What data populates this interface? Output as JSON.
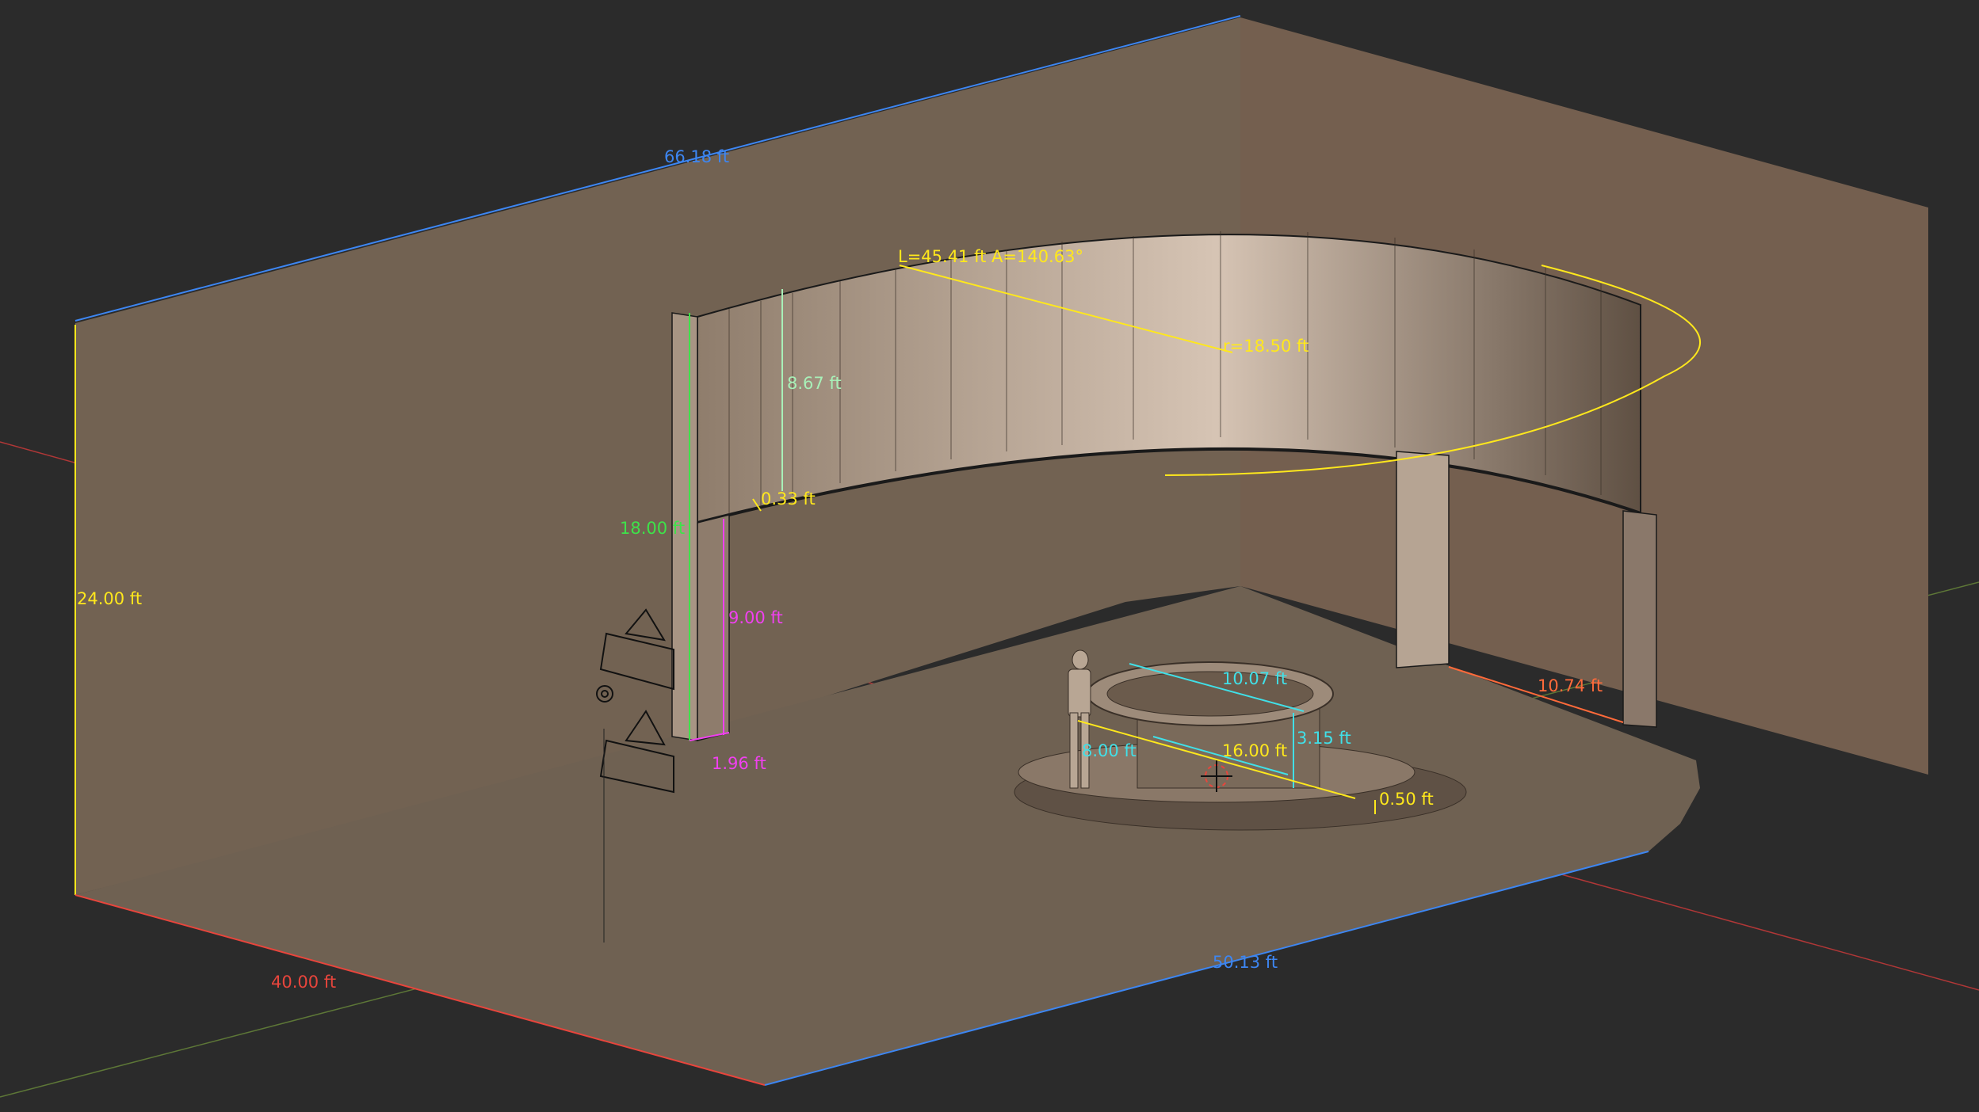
{
  "colors": {
    "background": "#2b2b2b",
    "wall": "#726252",
    "floor": "#6f6152",
    "screen_light": "#d2c0b0",
    "screen_dark": "#5f5043",
    "x_axis": "#d23a3a",
    "y_axis": "#6a8a3a",
    "blue_dim": "#3d86f2",
    "red_dim": "#e8453c",
    "yellow_dim": "#ffe81c",
    "green_dim": "#3ee24a",
    "cyan_dim": "#40e0e8",
    "magenta_dim": "#f040f0",
    "mint_dim": "#a8f0b8",
    "orange_dim": "#ff6a3a"
  },
  "dimensions": {
    "top_wall_length": "66.18 ft",
    "wall_height": "24.00 ft",
    "left_floor_depth": "40.00 ft",
    "front_floor_width": "50.13 ft",
    "arc_info": "L=45.41 ft A=140.63°",
    "arc_radius": "r=18.50 ft",
    "screen_height": "8.67 ft",
    "screen_thickness": "0.33 ft",
    "screen_top_height": "18.00 ft",
    "pillar_height": "9.00 ft",
    "pillar_width": "1.96 ft",
    "pillar_spacing": "10.74 ft",
    "desk_top_diameter": "10.07 ft",
    "desk_height": "3.15 ft",
    "desk_inner_diameter": "8.00 ft",
    "platform_diameter": "16.00 ft",
    "platform_height": "0.50 ft"
  },
  "icons": {
    "camera_top": "camera-icon",
    "camera_bottom": "camera-icon",
    "light": "light-gear-icon",
    "cursor": "3d-cursor-icon",
    "figure": "human-figure-icon"
  }
}
